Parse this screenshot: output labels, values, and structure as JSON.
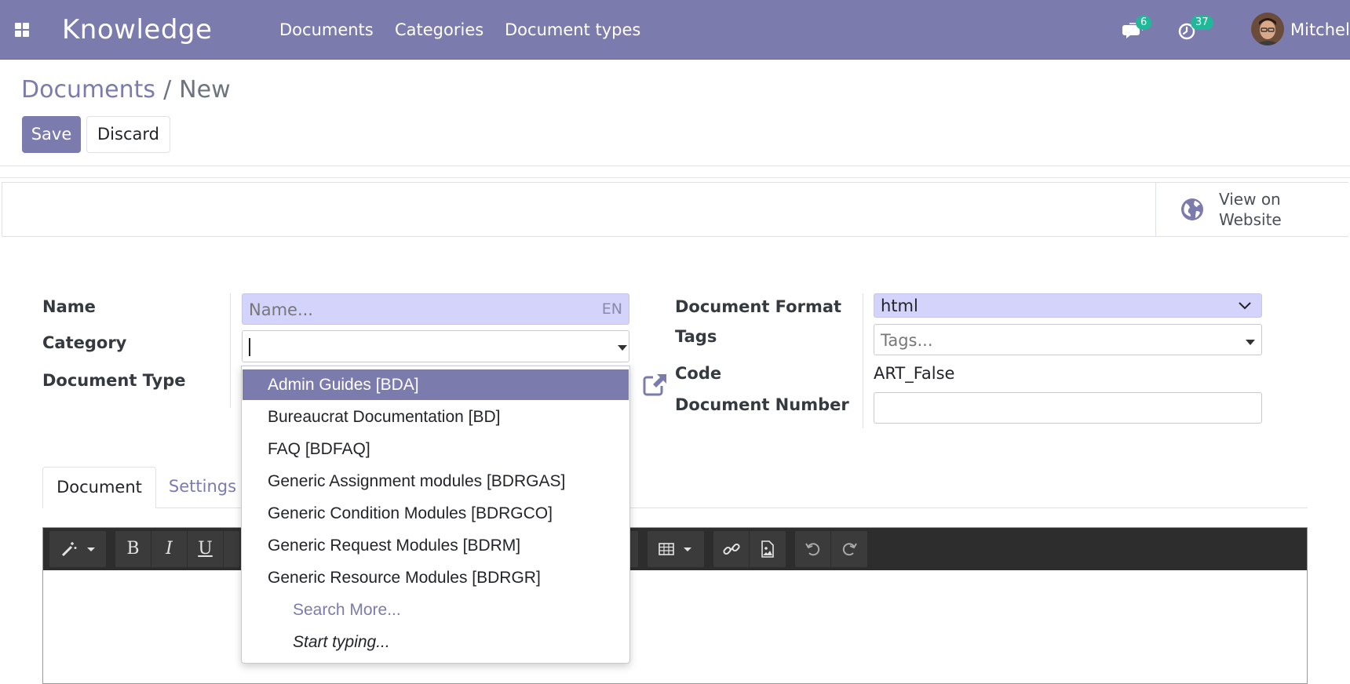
{
  "navbar": {
    "brand": "Knowledge",
    "menu": [
      "Documents",
      "Categories",
      "Document types"
    ],
    "messages_count": "6",
    "activities_count": "37",
    "user_name": "Mitchell"
  },
  "breadcrumb": {
    "parent": "Documents",
    "separator": "/",
    "current": "New"
  },
  "actions": {
    "save": "Save",
    "discard": "Discard"
  },
  "smart_button": {
    "line1": "View on",
    "line2": "Website"
  },
  "form": {
    "name_label": "Name",
    "name_placeholder": "Name...",
    "name_lang": "EN",
    "category_label": "Category",
    "category_value": "",
    "document_type_label": "Document Type",
    "format_label": "Document Format",
    "format_value": "html",
    "tags_label": "Tags",
    "tags_placeholder": "Tags...",
    "code_label": "Code",
    "code_value": "ART_False",
    "number_label": "Document Number",
    "number_value": ""
  },
  "tabs": {
    "active": "Document",
    "other": "Settings"
  },
  "category_dropdown": {
    "options": [
      "Admin Guides [BDA]",
      "Bureaucrat Documentation [BD]",
      "FAQ [BDFAQ]",
      "Generic Assignment modules [BDRGAS]",
      "Generic Condition Modules [BDRGCO]",
      "Generic Request Modules [BDRM]",
      "Generic Resource Modules [BDRGR]"
    ],
    "search_more": "Search More...",
    "start_typing": "Start typing..."
  },
  "editor_toolbar": {
    "bold": "B",
    "italic": "I",
    "underline": "U"
  },
  "colors": {
    "primary": "#7c7bad",
    "badge": "#21b799",
    "highlight_input": "#d3d3fb"
  }
}
